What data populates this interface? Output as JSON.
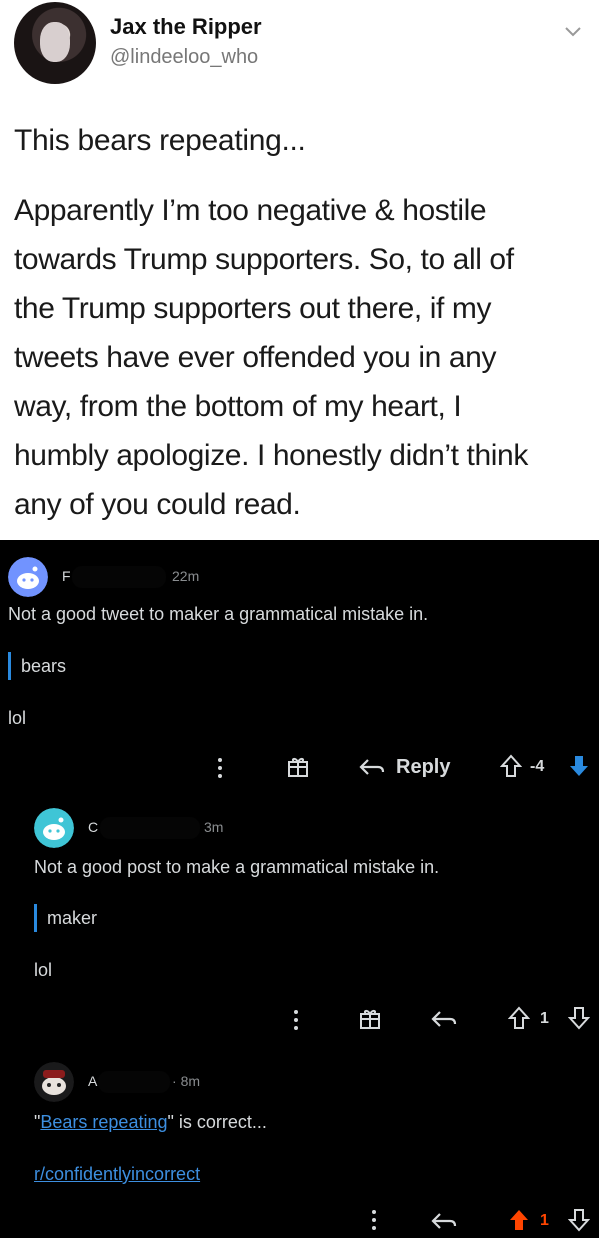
{
  "tweet": {
    "display_name": "Jax the Ripper",
    "handle": "@lindeeloo_who",
    "intro": "This bears repeating...",
    "body_lines": [
      "Apparently I’m too negative & hostile",
      "towards Trump supporters. So, to all of",
      "the Trump supporters out there, if my",
      "tweets have ever offended you in any",
      "way, from the bottom of my heart, I",
      "humbly apologize. I honestly didn’t think",
      "any of you could read."
    ]
  },
  "comments": [
    {
      "initial": "F",
      "time": "22m",
      "text": "Not a good tweet to maker a grammatical mistake in.",
      "quote": "bears",
      "after": "lol",
      "reply_label": "Reply",
      "score": "-4"
    },
    {
      "initial": "C",
      "time": "3m",
      "text": "Not a good post to make a grammatical mistake in.",
      "quote": "maker",
      "after": "lol",
      "score": "1"
    },
    {
      "initial": "A",
      "time": "8m",
      "text_link": "Bears repeating",
      "text_rest": " is correct...",
      "quote_open": "\"",
      "quote_close": "\"",
      "subreddit_link": "r/confidentlyincorrect",
      "score": "1"
    }
  ],
  "colors": {
    "accent_blue": "#3d8fe0",
    "upvote_orange": "#ff4500",
    "downvote_blue": "#2a8adf"
  }
}
